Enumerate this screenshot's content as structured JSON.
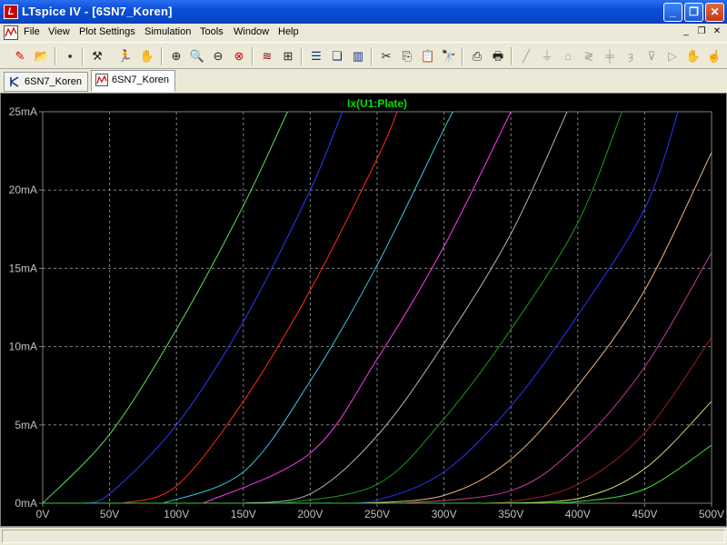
{
  "window": {
    "app_icon": "ltspice-icon",
    "title": "LTspice IV - [6SN7_Koren]",
    "buttons": [
      "minimize-icon",
      "restore-icon",
      "close-icon"
    ]
  },
  "menu": {
    "items": [
      "File",
      "View",
      "Plot Settings",
      "Simulation",
      "Tools",
      "Window",
      "Help"
    ]
  },
  "toolbar": {
    "icons": [
      "run-icon",
      "open-icon",
      "save-icon",
      "control-panel-icon",
      "run-sim-icon",
      "pan-hand-icon",
      "zoom-in-icon",
      "zoom-out-area-icon",
      "zoom-out-icon",
      "zoom-cancel-icon",
      "autorange-icon",
      "grid-icon",
      "tile-horizontal-icon",
      "cascade-icon",
      "tile-vertical-icon",
      "cut-icon",
      "copy-icon",
      "find-icon",
      "print-preview-icon",
      "print-icon",
      "wire-icon",
      "ground-icon",
      "label-icon",
      "resistor-icon",
      "capacitor-icon",
      "inductor-icon",
      "diode-icon",
      "component-icon",
      "move-icon",
      "drag-icon"
    ]
  },
  "tabs": [
    {
      "label": "6SN7_Koren",
      "icon": "schematic-icon",
      "active": false
    },
    {
      "label": "6SN7_Koren",
      "icon": "waveform-icon",
      "active": true
    }
  ],
  "colors": {
    "background": "#000000",
    "grid": "#808080",
    "axis_text": "#c0c0c0",
    "trace_title": "#00e000"
  },
  "chart_data": {
    "type": "line",
    "title": "Ix(U1:Plate)",
    "xlabel": "",
    "ylabel": "",
    "xlim": [
      0,
      500
    ],
    "ylim": [
      0,
      25
    ],
    "x_ticks": [
      "0V",
      "50V",
      "100V",
      "150V",
      "200V",
      "250V",
      "300V",
      "350V",
      "400V",
      "450V",
      "500V"
    ],
    "y_ticks": [
      "0mA",
      "5mA",
      "10mA",
      "15mA",
      "20mA",
      "25mA"
    ],
    "grid": true,
    "x_unit": "V",
    "y_unit": "mA",
    "series": [
      {
        "color": "#5ee05e",
        "x": [
          0,
          50,
          100,
          150,
          183
        ],
        "y": [
          0,
          4.4,
          11.1,
          19.0,
          25.0
        ]
      },
      {
        "color": "#2a3cff",
        "x": [
          30,
          50,
          100,
          150,
          200,
          224
        ],
        "y": [
          0,
          0.6,
          5.0,
          11.6,
          20.0,
          25.0
        ]
      },
      {
        "color": "#ff2a1a",
        "x": [
          60,
          100,
          150,
          200,
          250,
          265
        ],
        "y": [
          0,
          1.1,
          6.5,
          13.6,
          22.0,
          25.0
        ]
      },
      {
        "color": "#3ac6e0",
        "x": [
          90,
          150,
          200,
          250,
          300,
          307
        ],
        "y": [
          0,
          2.0,
          7.8,
          15.2,
          23.9,
          25.0
        ]
      },
      {
        "color": "#ff3cf0",
        "x": [
          120,
          200,
          250,
          300,
          350
        ],
        "y": [
          0,
          3.2,
          9.2,
          16.4,
          25.0
        ]
      },
      {
        "color": "#b4b4b4",
        "x": [
          150,
          200,
          250,
          300,
          350,
          392
        ],
        "y": [
          0,
          0.6,
          4.3,
          10.2,
          17.2,
          25.0
        ]
      },
      {
        "color": "#1c9a1c",
        "x": [
          180,
          250,
          300,
          350,
          400,
          433
        ],
        "y": [
          0,
          1.2,
          5.4,
          11.1,
          17.9,
          25.0
        ]
      },
      {
        "color": "#2636ff",
        "x": [
          210,
          250,
          300,
          350,
          400,
          450,
          475
        ],
        "y": [
          0,
          0.2,
          2.0,
          6.2,
          12.0,
          18.8,
          25.0
        ]
      },
      {
        "color": "#f0b47c",
        "x": [
          240,
          300,
          350,
          400,
          450,
          500
        ],
        "y": [
          0,
          0.5,
          2.8,
          7.5,
          13.6,
          22.4
        ]
      },
      {
        "color": "#c83ca0",
        "x": [
          270,
          350,
          400,
          450,
          500
        ],
        "y": [
          0,
          0.8,
          3.7,
          8.7,
          16.0
        ]
      },
      {
        "color": "#a01e1e",
        "x": [
          300,
          350,
          400,
          450,
          500
        ],
        "y": [
          0,
          0.1,
          1.2,
          4.5,
          10.6
        ]
      },
      {
        "color": "#d2d27a",
        "x": [
          330,
          400,
          450,
          500
        ],
        "y": [
          0,
          0.3,
          2.2,
          6.5
        ]
      },
      {
        "color": "#38e038",
        "x": [
          360,
          400,
          450,
          500
        ],
        "y": [
          0,
          0.1,
          0.9,
          3.7
        ]
      }
    ]
  }
}
